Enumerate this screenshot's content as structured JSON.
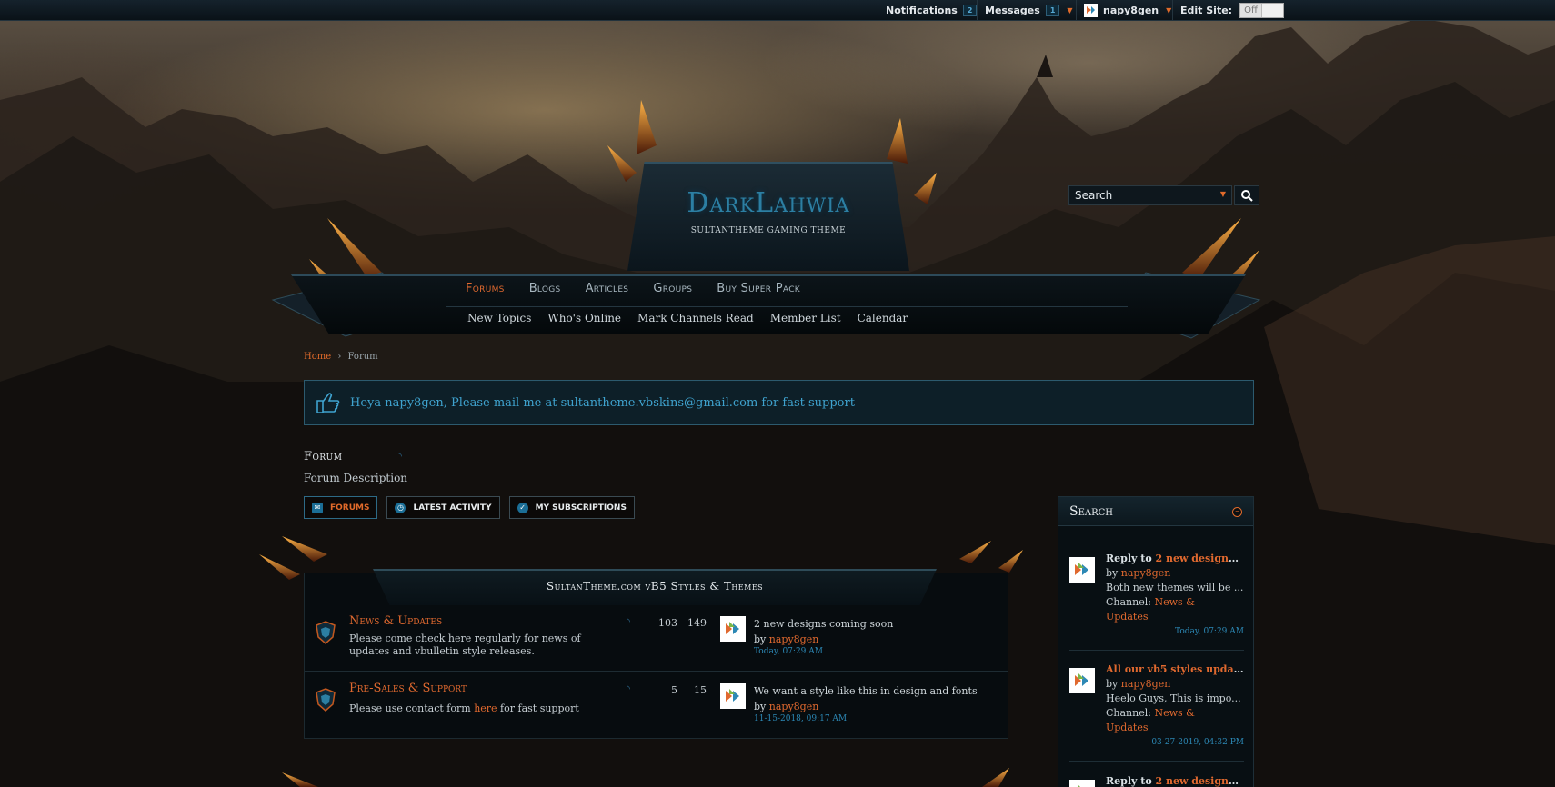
{
  "topbar": {
    "notifications_label": "Notifications",
    "notifications_count": "2",
    "messages_label": "Messages",
    "messages_count": "1",
    "username": "napy8gen",
    "edit_site_label": "Edit Site:",
    "edit_site_state": "Off"
  },
  "header": {
    "logo_text": "DarkLahwia",
    "logo_subtitle": "SULTANTHEME GAMING THEME",
    "search_placeholder": "Search"
  },
  "nav": {
    "main": [
      {
        "label": "Forums",
        "active": true
      },
      {
        "label": "Blogs",
        "active": false
      },
      {
        "label": "Articles",
        "active": false
      },
      {
        "label": "Groups",
        "active": false
      },
      {
        "label": "Buy Super Pack",
        "active": false
      }
    ],
    "sub": [
      "New Topics",
      "Who's Online",
      "Mark Channels Read",
      "Member List",
      "Calendar"
    ]
  },
  "breadcrumb": {
    "home": "Home",
    "separator": "›",
    "current": "Forum"
  },
  "notice": {
    "text": "Heya napy8gen, Please mail me at sultantheme.vbskins@gmail.com for fast support"
  },
  "page": {
    "title": "Forum",
    "description": "Forum Description",
    "tabs": [
      {
        "label": "FORUMS",
        "icon": "chat-bubbles-icon",
        "active": true
      },
      {
        "label": "LATEST ACTIVITY",
        "icon": "clock-icon",
        "active": false
      },
      {
        "label": "MY SUBSCRIPTIONS",
        "icon": "check-circle-icon",
        "active": false
      }
    ]
  },
  "category": {
    "title": "SultanTheme.com vB5 Styles & Themes",
    "forums": [
      {
        "title": "News & Updates",
        "description": "Please come check here regularly for news of updates and vbulletin style releases.",
        "desc_link": "",
        "desc_after": "",
        "topics": "103",
        "posts": "149",
        "last_post_title": "2 new designs coming soon",
        "last_post_by": "by",
        "last_post_user": "napy8gen",
        "last_post_date": "Today, 07:29 AM"
      },
      {
        "title": "Pre-Sales & Support",
        "description": "Please use contact form ",
        "desc_link": "here",
        "desc_after": " for fast support",
        "topics": "5",
        "posts": "15",
        "last_post_title": "We want a style like this in design and fonts",
        "last_post_by": "by",
        "last_post_user": "napy8gen",
        "last_post_date": "11-15-2018, 09:17 AM"
      }
    ]
  },
  "sidebar": {
    "title": "Search",
    "items": [
      {
        "prefix": "Reply to ",
        "link": "2 new designs c...",
        "by": "by ",
        "user": "napy8gen",
        "excerpt": "Both new themes will be ...",
        "channel_label": "Channel: ",
        "channel": "News &",
        "channel2": "Updates",
        "date": "Today, 07:29 AM"
      },
      {
        "prefix": "",
        "link": "All our vb5 styles update...",
        "by": "by ",
        "user": "napy8gen",
        "excerpt": "Heelo Guys, This is impo...",
        "channel_label": "Channel: ",
        "channel": "News &",
        "channel2": "Updates",
        "date": "03-27-2019, 04:32 PM"
      },
      {
        "prefix": "Reply to ",
        "link": "2 new designs c..."
      }
    ]
  },
  "colors": {
    "accent": "#e0692f",
    "link_blue": "#2c88b5",
    "logo_blue": "#2c7fa3"
  }
}
